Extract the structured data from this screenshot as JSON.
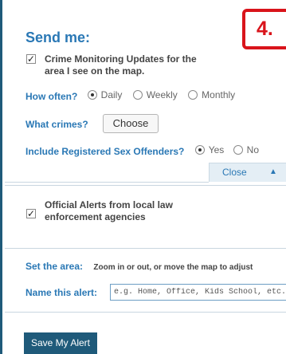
{
  "step_badge": "4.",
  "title": "Send me:",
  "crime_updates": {
    "checked": true,
    "label_line1": "Crime Monitoring Updates for the",
    "label_line2": "area I see on the map."
  },
  "how_often": {
    "label": "How often?",
    "options": [
      "Daily",
      "Weekly",
      "Monthly"
    ],
    "selected": "Daily"
  },
  "what_crimes": {
    "label": "What crimes?",
    "button": "Choose"
  },
  "sex_offenders": {
    "label": "Include Registered Sex Offenders?",
    "options": [
      "Yes",
      "No"
    ],
    "selected": "Yes"
  },
  "close_bar": {
    "label": "Close",
    "arrow": "▲"
  },
  "official_alerts": {
    "checked": true,
    "label_line1": "Official Alerts from local law",
    "label_line2": "enforcement agencies"
  },
  "set_area": {
    "label": "Set the area:",
    "help": "Zoom in or out, or move the map to adjust"
  },
  "name_alert": {
    "label": "Name this alert:",
    "placeholder": "e.g. Home, Office, Kids School, etc."
  },
  "save_button": "Save My Alert",
  "colors": {
    "accent_blue": "#2a78b5",
    "panel_border": "#1f5a7a",
    "badge_red": "#d9141b"
  }
}
